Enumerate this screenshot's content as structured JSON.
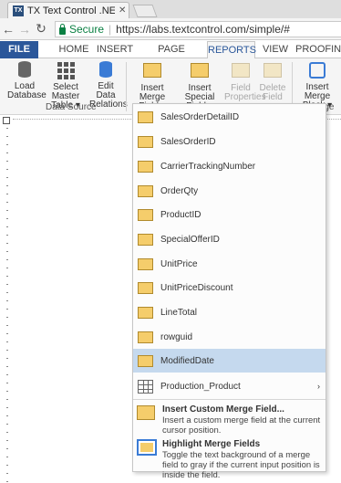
{
  "browser": {
    "tab_title": "TX Text Control .NET Serv",
    "tab_favicon": "TX",
    "secure_label": "Secure",
    "url": "https://labs.textcontrol.com/simple/#"
  },
  "ribbon": {
    "tabs": [
      "FILE",
      "HOME",
      "INSERT",
      "PAGE LAYOUT",
      "REPORTS",
      "VIEW",
      "PROOFING"
    ],
    "active_tab": "REPORTS",
    "buttons": {
      "load_database": "Load Database",
      "select_master_table": "Select Master Table ▾",
      "edit_data_relations": "Edit Data Relations",
      "insert_merge_field": "Insert Merge Field ▾",
      "insert_special_field": "Insert Special Field ▾",
      "field_properties": "Field Properties",
      "delete_field": "Delete Field",
      "insert_merge_block": "Insert Merge Block ▾"
    },
    "group_labels": {
      "data_source": "Data Source",
      "merge_blocks_partial": "rge B"
    }
  },
  "menu": {
    "fields": [
      "SalesOrderDetailID",
      "SalesOrderID",
      "CarrierTrackingNumber",
      "OrderQty",
      "ProductID",
      "SpecialOfferID",
      "UnitPrice",
      "UnitPriceDiscount",
      "LineTotal",
      "rowguid",
      "ModifiedDate"
    ],
    "highlighted": "ModifiedDate",
    "submenu_item": "Production_Product",
    "custom_field": {
      "title": "Insert Custom Merge Field...",
      "desc": "Insert a custom merge field at the current cursor position."
    },
    "highlight_fields": {
      "title": "Highlight Merge Fields",
      "desc": "Toggle the text background of a merge field to gray if the current input position is inside the field."
    }
  },
  "icons": {
    "ruler_corner": "tab-stop-icon",
    "chevron": "›"
  },
  "colors": {
    "file_tab": "#2b579a",
    "highlight": "#c5d9ee",
    "field_icon": "#f5cd6b",
    "secure": "#0b8043"
  }
}
